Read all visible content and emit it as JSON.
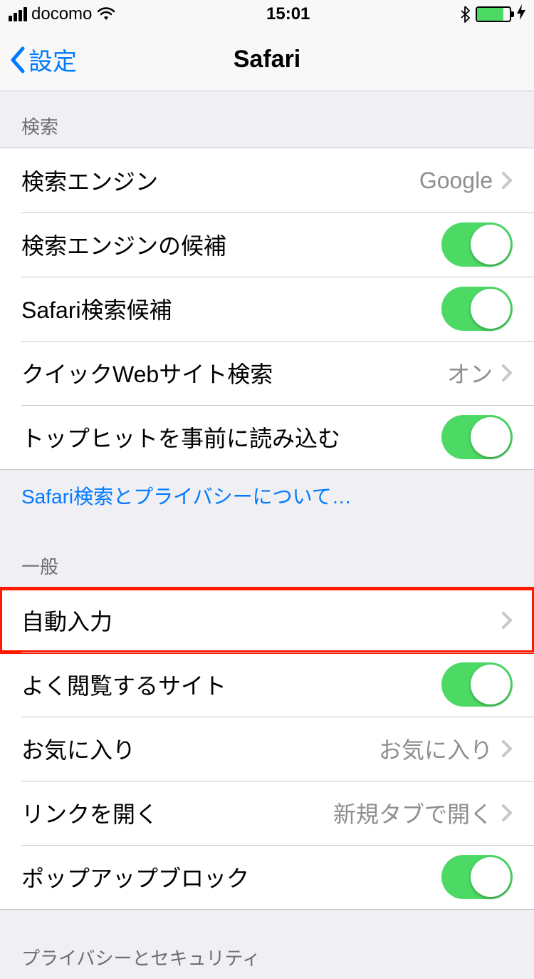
{
  "status": {
    "carrier": "docomo",
    "time": "15:01"
  },
  "nav": {
    "back_label": "設定",
    "title": "Safari"
  },
  "sections": {
    "search": {
      "header": "検索",
      "engine_label": "検索エンジン",
      "engine_value": "Google",
      "engine_suggest_label": "検索エンジンの候補",
      "safari_suggest_label": "Safari検索候補",
      "quick_web_label": "クイックWebサイト検索",
      "quick_web_value": "オン",
      "tophit_label": "トップヒットを事前に読み込む",
      "footer_link": "Safari検索とプライバシーについて…"
    },
    "general": {
      "header": "一般",
      "autofill_label": "自動入力",
      "freq_sites_label": "よく閲覧するサイト",
      "favorites_label": "お気に入り",
      "favorites_value": "お気に入り",
      "open_links_label": "リンクを開く",
      "open_links_value": "新規タブで開く",
      "popup_label": "ポップアップブロック"
    },
    "privacy": {
      "header": "プライバシーとセキュリティ"
    }
  }
}
